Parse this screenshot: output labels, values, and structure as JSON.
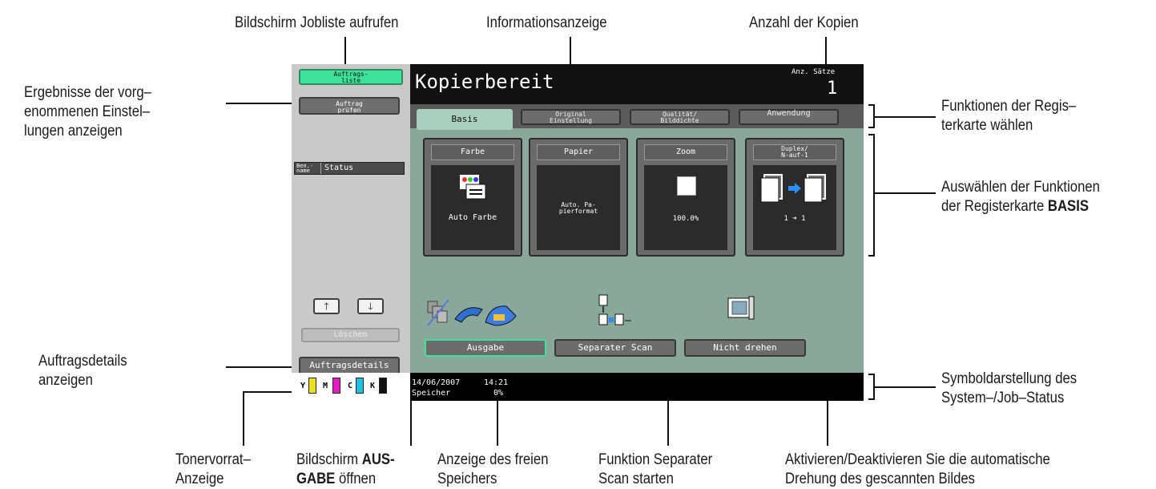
{
  "annotations": {
    "joblist": "Bildschirm Jobliste aufrufen",
    "info": "Informationsanzeige",
    "copies": "Anzahl der Kopien",
    "results_1": "Ergebnisse der vorg–",
    "results_2": "enommenen Einstel–",
    "results_3": "lungen anzeigen",
    "tabs_1": "Funktionen der Regis–",
    "tabs_2": "terkarte wählen",
    "basis_1": "Auswählen der Funktionen",
    "basis_2a": "der Registerkarte ",
    "basis_2b": "BASIS",
    "details_1": "Auftragsdetails",
    "details_2": "anzeigen",
    "symbol_1": "Symboldarstellung des",
    "symbol_2": "System–/Job–Status",
    "toner_1": "Tonervorrat–",
    "toner_2": "Anzeige",
    "ausgabe_1a": "Bildschirm ",
    "ausgabe_1b": "AUS-",
    "ausgabe_2a": "GABE",
    "ausgabe_2b": " öffnen",
    "memory_1": "Anzeige des freien",
    "memory_2": "Speichers",
    "separate_1": "Funktion Separater",
    "separate_2": "Scan starten",
    "rotate_1": "Aktivieren/Deaktivieren Sie die automatische",
    "rotate_2": "Drehung des gescannten Bildes"
  },
  "screen": {
    "sidebar": {
      "joblist_btn": "Auftrags-\nliste",
      "check_btn": "Auftrag\nprüfen",
      "col_name": "Ben.-\nname",
      "col_status": "Status",
      "delete_btn": "Löschen",
      "details_btn": "Auftragsdetails",
      "toner": [
        "Y",
        "M",
        "C",
        "K"
      ]
    },
    "header": {
      "title": "Kopierbereit",
      "sets_label": "Anz. Sätze",
      "sets_value": "1"
    },
    "tabs": [
      "Basis",
      "Original\nEinstellung",
      "Qualität/\nBilddichte",
      "Anwendung"
    ],
    "tiles": [
      {
        "title": "Farbe",
        "value": "Auto Farbe"
      },
      {
        "title": "Papier",
        "value": "Auto. Pa-\npierformat"
      },
      {
        "title": "Zoom",
        "value": "100.0%"
      },
      {
        "title": "Duplex/\nN-auf-1",
        "value": "1 ➜ 1"
      }
    ],
    "func_buttons": [
      "Ausgabe",
      "Separater Scan",
      "Nicht drehen"
    ],
    "status": {
      "date": "14/06/2007",
      "time": "14:21",
      "memory_label": "Speicher",
      "memory_value": "0%"
    }
  },
  "colors": {
    "accent_green": "#3fe29a",
    "panel_bg": "#8aa79c",
    "active_tab": "#a8cfc0",
    "toner_y": "#e8e020",
    "toner_m": "#e020c0",
    "toner_c": "#20c0e0",
    "toner_k": "#111111"
  }
}
